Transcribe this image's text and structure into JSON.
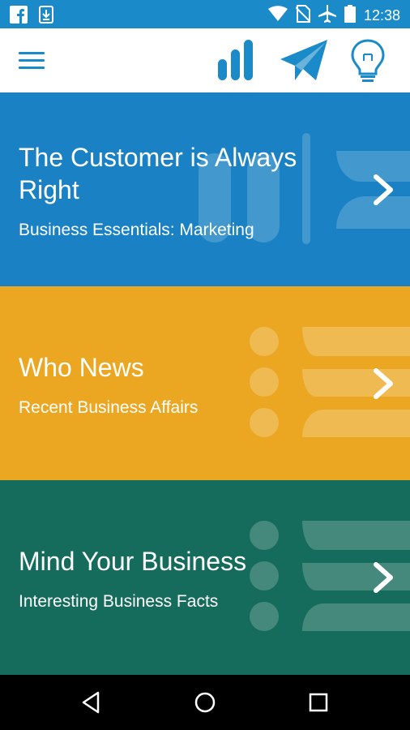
{
  "status_bar": {
    "time": "12:38",
    "icons": [
      "facebook-icon",
      "download-icon",
      "wifi-icon",
      "no-sim-icon",
      "airplane-icon",
      "battery-icon"
    ]
  },
  "app_bar": {
    "icons": [
      "menu-icon",
      "stats-icon",
      "send-icon",
      "lightbulb-icon"
    ],
    "accent": "#1a8ac8"
  },
  "cards": [
    {
      "title": "The Customer is Always Right",
      "subtitle": "Business Essentials: Marketing",
      "color": "#1a82c4"
    },
    {
      "title": "Who News",
      "subtitle": "Recent Business Affairs",
      "color": "#eba722"
    },
    {
      "title": "Mind Your Business",
      "subtitle": "Interesting Business Facts",
      "color": "#166c5c"
    }
  ],
  "nav_bar": {
    "icons": [
      "back-icon",
      "home-icon",
      "recents-icon"
    ]
  }
}
